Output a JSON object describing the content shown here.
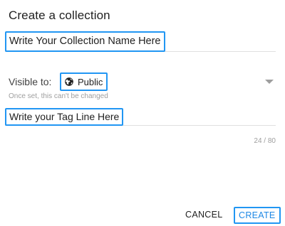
{
  "dialog": {
    "title": "Create a collection",
    "name_input": {
      "value": "Write Your Collection Name Here"
    },
    "visibility": {
      "label": "Visible to:",
      "selected": "Public",
      "icon": "globe-icon",
      "helper": "Once set, this can't be changed"
    },
    "tagline_input": {
      "value": "Write your Tag Line Here",
      "counter": "24 / 80"
    },
    "actions": {
      "cancel_label": "CANCEL",
      "create_label": "CREATE"
    }
  },
  "colors": {
    "accent": "#2196f3",
    "create_text": "#1e88e5",
    "helper_text": "#9e9e9e",
    "divider": "#e0e0e0"
  }
}
